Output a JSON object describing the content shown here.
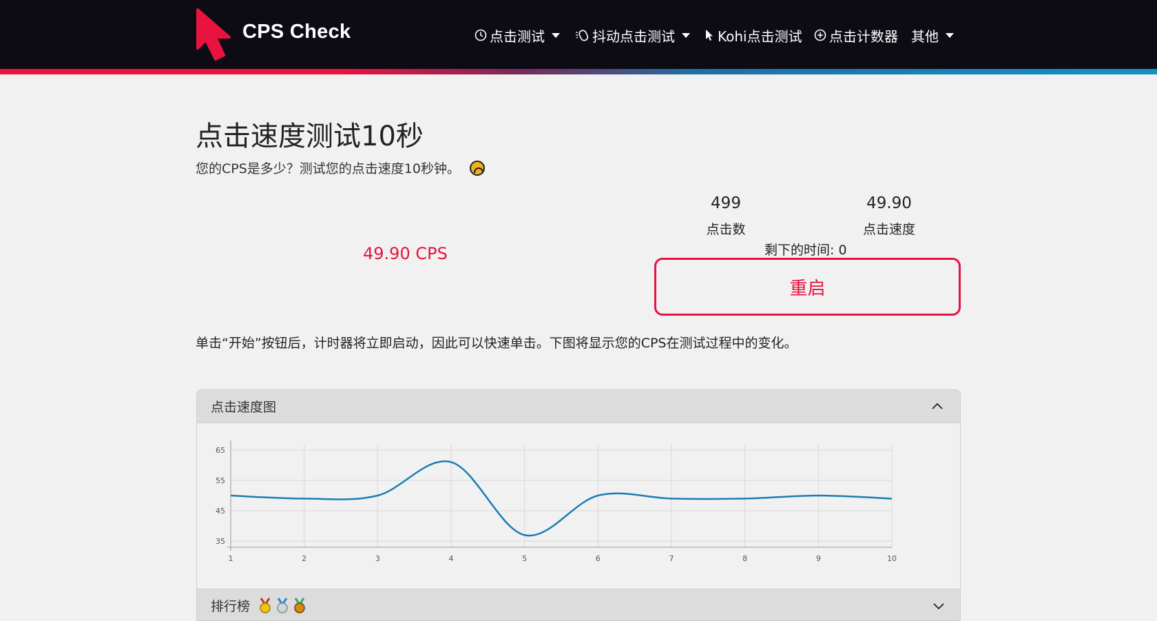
{
  "header": {
    "brand": "CPS Check",
    "nav": [
      {
        "label": "点击测试",
        "icon": "clock-icon",
        "dropdown": true
      },
      {
        "label": "抖动点击测试",
        "icon": "mouse-jitter-icon",
        "dropdown": true
      },
      {
        "label": "Kohi点击测试",
        "icon": "cursor-icon",
        "dropdown": false
      },
      {
        "label": "点击计数器",
        "icon": "plus-circle-icon",
        "dropdown": false
      },
      {
        "label": "其他",
        "icon": "",
        "dropdown": true
      }
    ],
    "colors": {
      "bar": "#0d0c14",
      "accent_red": "#e8133e",
      "accent_blue": "#1391c7"
    }
  },
  "main": {
    "title": "点击速度测试10秒",
    "subtitle": "您的CPS是多少？测试您的点击速度10秒钟。",
    "result_cps": "49.90 CPS",
    "stats": {
      "clicks_value": "499",
      "clicks_label": "点击数",
      "speed_value": "49.90",
      "speed_label": "点击速度",
      "time_left": "剩下的时间: 0"
    },
    "restart_label": "重启",
    "instructions": "单击“开始”按钮后，计时器将立即启动，因此可以快速单击。下图将显示您的CPS在测试过程中的变化。"
  },
  "accordion": {
    "chart_title": "点击速度图",
    "leaderboard_title": "排行榜"
  },
  "chart_data": {
    "type": "line",
    "x": [
      1,
      2,
      3,
      4,
      5,
      6,
      7,
      8,
      9,
      10
    ],
    "series": [
      {
        "values": [
          50,
          49,
          50,
          61,
          37,
          50,
          49,
          49,
          50,
          49
        ]
      }
    ],
    "xticks": [
      "1",
      "2",
      "3",
      "4",
      "5",
      "6",
      "7",
      "8",
      "9",
      "10"
    ],
    "yticks": [
      "35",
      "45",
      "55",
      "65"
    ],
    "ylim": [
      33,
      67
    ],
    "grid": true,
    "line_color": "#1a7db5"
  }
}
